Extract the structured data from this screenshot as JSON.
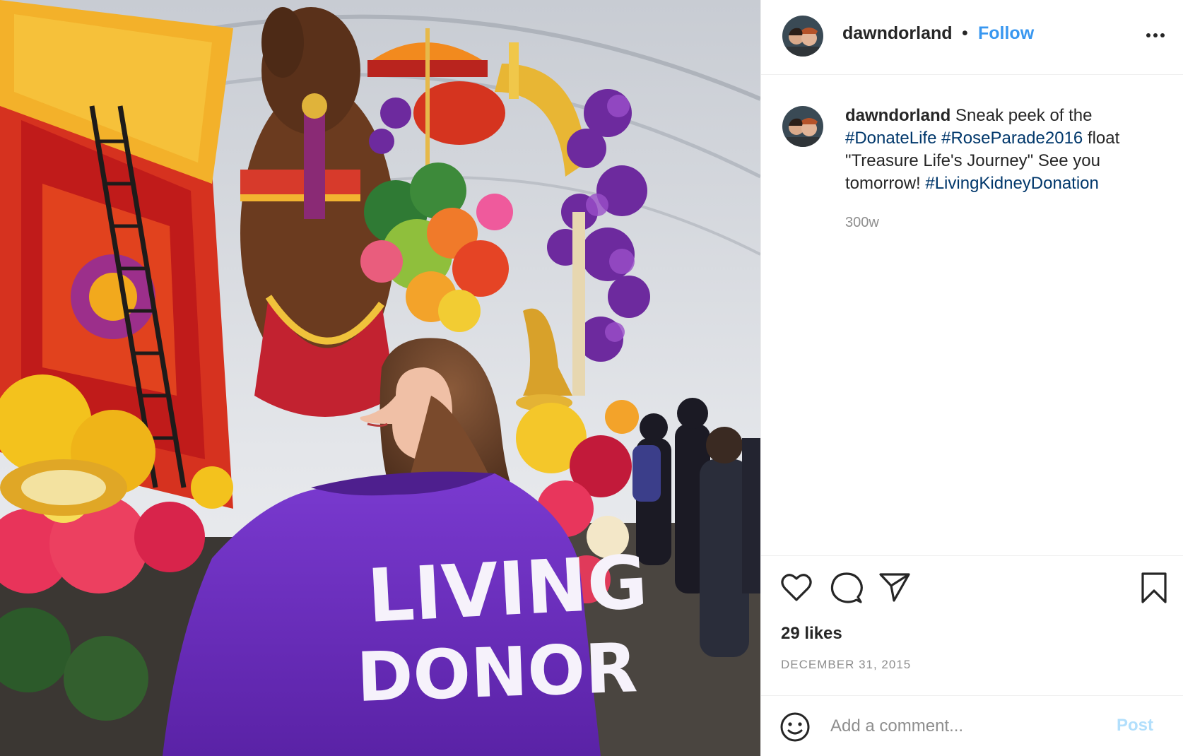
{
  "post": {
    "username": "dawndorland",
    "separator": "•",
    "follow_label": "Follow",
    "more_icon": "more-options-icon",
    "caption": {
      "username": "dawndorland",
      "text_1": " Sneak peek of the ",
      "tag_1": "#DonateLife",
      "text_2": " ",
      "tag_2": "#RoseParade2016",
      "text_3": " float \"Treasure Life's Journey\" See you tomorrow! ",
      "tag_3": "#LivingKidneyDonation"
    },
    "time_ago": "300w",
    "likes": "29 likes",
    "date": "DECEMBER 31, 2015",
    "comment_placeholder": "Add a comment...",
    "post_label": "Post",
    "photo_text": {
      "line1": "LIVING",
      "line2": "DONOR"
    }
  },
  "icons": [
    "heart-icon",
    "comment-icon",
    "share-icon",
    "bookmark-icon",
    "emoji-icon"
  ],
  "colors": {
    "accent": "#3897f0",
    "hashtag": "#00376b",
    "post_disabled": "#b2dffc",
    "secondary_text": "#8e8e8e",
    "jacket": "#6a2fb8"
  }
}
